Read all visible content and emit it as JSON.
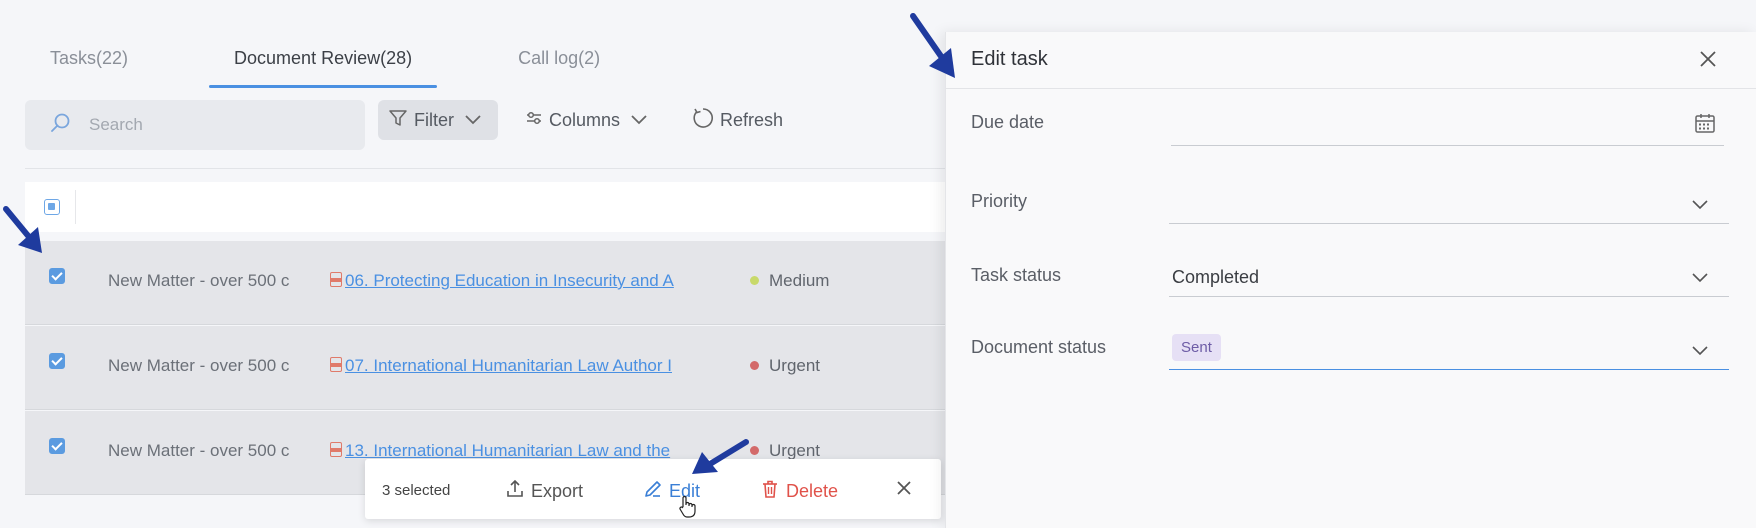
{
  "tabs": [
    {
      "label": "Tasks(22)",
      "active": false
    },
    {
      "label": "Document Review(28)",
      "active": true
    },
    {
      "label": "Call log(2)",
      "active": false
    }
  ],
  "toolbar": {
    "search_placeholder": "Search",
    "filter_label": "Filter",
    "columns_label": "Columns",
    "refresh_label": "Refresh"
  },
  "rows": [
    {
      "matter": "New Matter - over 500 c",
      "document": "06. Protecting Education in Insecurity and A",
      "priority": "Medium",
      "priority_color": "#c8d96a",
      "checked": true
    },
    {
      "matter": "New Matter - over 500 c",
      "document": "07. International Humanitarian Law Author I",
      "priority": "Urgent",
      "priority_color": "#d36a6a",
      "checked": true
    },
    {
      "matter": "New Matter - over 500 c",
      "document": "13. International Humanitarian Law and the",
      "priority": "Urgent",
      "priority_color": "#d36a6a",
      "checked": true
    }
  ],
  "actionbar": {
    "selected_count": "3 selected",
    "export_label": "Export",
    "edit_label": "Edit",
    "delete_label": "Delete"
  },
  "panel": {
    "title": "Edit task",
    "due_date_label": "Due date",
    "due_date_value": "",
    "priority_label": "Priority",
    "priority_value": "",
    "task_status_label": "Task status",
    "task_status_value": "Completed",
    "document_status_label": "Document status",
    "document_status_value": "Sent"
  },
  "colors": {
    "accent": "#4a90e2",
    "danger": "#e0524a",
    "annotation_arrow": "#1f3b9e"
  }
}
